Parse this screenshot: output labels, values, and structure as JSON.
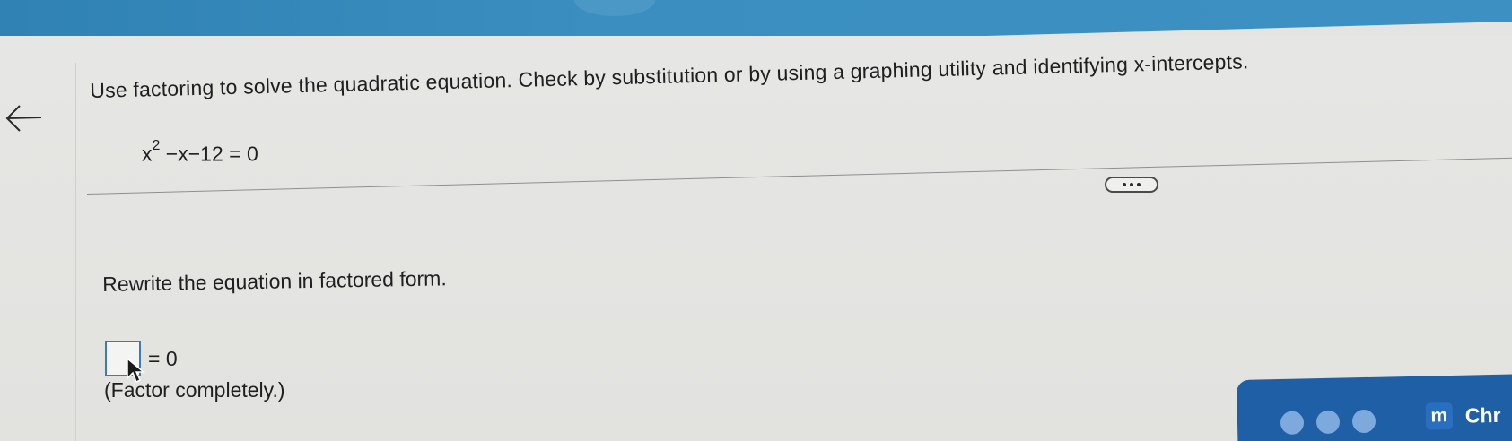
{
  "question": {
    "prompt": "Use factoring to solve the quadratic equation. Check by substitution or by using a graphing utility and identifying x-intercepts.",
    "equation_lead": "x",
    "equation_exponent": "2",
    "equation_rest": "−x−12 = 0"
  },
  "part": {
    "instruction": "Rewrite the equation in factored form.",
    "answer_value": "",
    "equals_text": "= 0",
    "note": "(Factor completely.)"
  },
  "toolbar": {
    "badge_letter": "m",
    "app_label": "Chr"
  },
  "colors": {
    "accent_blue": "#3c91c2",
    "answer_border": "#3f7ab5",
    "widget_blue": "#1f5fa6"
  },
  "icons": [
    "back-arrow-icon",
    "more-dots-icon",
    "mouse-pointer-icon"
  ]
}
